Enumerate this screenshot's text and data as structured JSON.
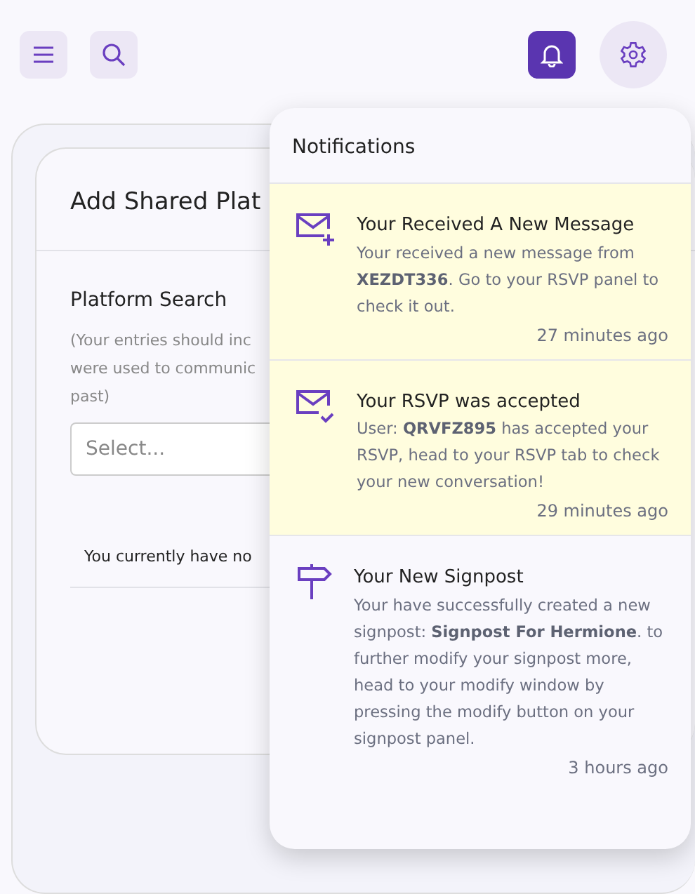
{
  "topbar": {
    "buttons": [
      {
        "kind": "menu",
        "selected": false
      },
      {
        "kind": "search",
        "selected": false
      },
      {
        "kind": "bell",
        "selected": true
      },
      {
        "kind": "gear",
        "selected": false
      }
    ]
  },
  "card": {
    "title": "Add Shared Plat",
    "field_label": "Platform Search",
    "hint_lines": [
      "(Your entries should inc",
      "were used to communic",
      "past)"
    ],
    "select": {
      "placeholder": "Select..."
    },
    "empty_text": "You currently have no"
  },
  "notifications": {
    "title": "Notifications",
    "items": [
      {
        "kind": "message-new",
        "unread": true,
        "title": "Your Received A New Message",
        "body": "Your received a new message from **XEZDT336**. Go to your RSVP panel to check it out.",
        "time": "27 minutes ago"
      },
      {
        "kind": "message-accepted",
        "unread": true,
        "title": "Your RSVP was accepted",
        "body": "User: **QRVFZ895** has accepted your RSVP, head to your RSVP tab to check your new conversation!",
        "time": "29 minutes ago"
      },
      {
        "kind": "signpost",
        "unread": false,
        "title": "Your New Signpost",
        "body": "Your have successfully created a new signpost: **Signpost For Hermione**. to further modify your signpost more, head to your modify window by pressing the modify button on your signpost panel.",
        "time": "3 hours ago"
      }
    ]
  }
}
